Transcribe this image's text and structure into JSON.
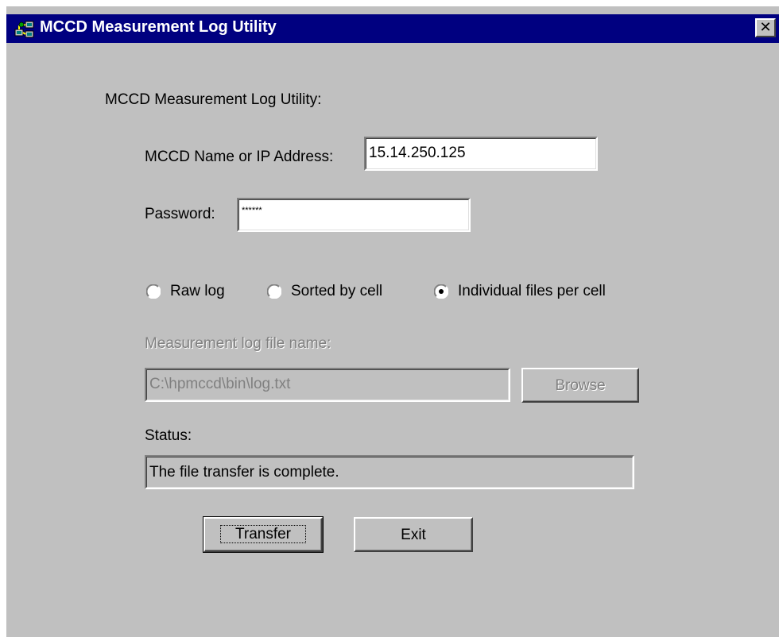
{
  "window": {
    "title": "MCCD Measurement Log Utility",
    "close_glyph": "✕"
  },
  "form": {
    "heading": "MCCD Measurement Log Utility:",
    "host_label": "MCCD Name or IP Address:",
    "host_value": "15.14.250.125",
    "password_label": "Password:",
    "password_value": "******"
  },
  "log_mode": {
    "options": [
      {
        "label": "Raw log",
        "selected": false
      },
      {
        "label": "Sorted by cell",
        "selected": false
      },
      {
        "label": "Individual files per cell",
        "selected": true
      }
    ]
  },
  "file": {
    "label": "Measurement log file name:",
    "path": "C:\\hpmccd\\bin\\log.txt",
    "browse_label": "Browse",
    "enabled": false
  },
  "status": {
    "label": "Status:",
    "text": "The file transfer is complete."
  },
  "actions": {
    "transfer_label": "Transfer",
    "exit_label": "Exit"
  },
  "colors": {
    "title_bar": "#000080",
    "dialog_face": "#c0c0c0",
    "disabled_text": "#808080"
  },
  "icons": {
    "app": "network-computers-icon",
    "close": "close-icon"
  }
}
